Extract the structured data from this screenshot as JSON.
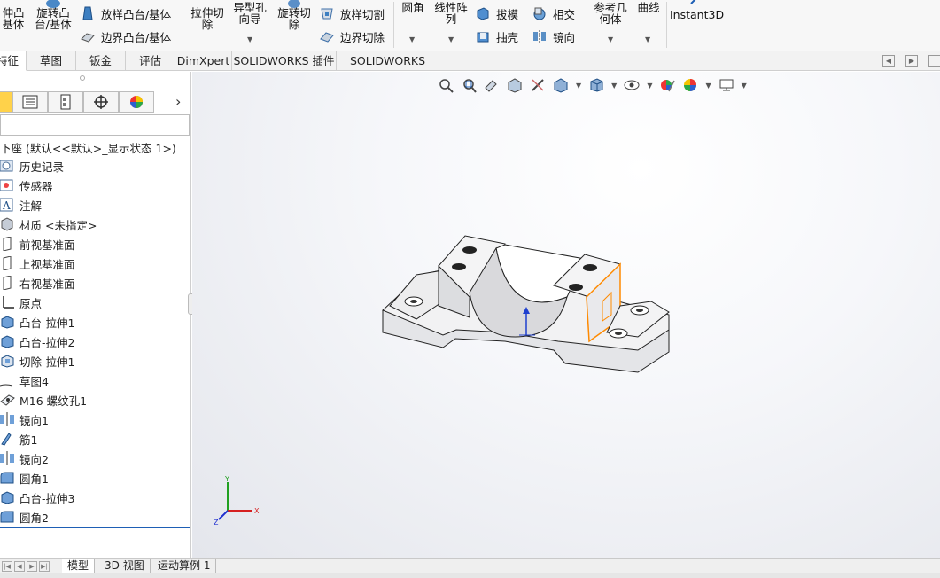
{
  "ribbon": {
    "extrude_boss": [
      "伸凸",
      "基体"
    ],
    "revolve_boss": [
      "旋转凸",
      "台/基体"
    ],
    "loft_boss": "放样凸台/基体",
    "boundary_boss": "边界凸台/基体",
    "extrude_cut": [
      "拉伸切",
      "除"
    ],
    "hole_wizard": [
      "异型孔",
      "向导"
    ],
    "revolve_cut": [
      "旋转切",
      "除"
    ],
    "loft_cut": "放样切割",
    "boundary_cut": "边界切除",
    "fillet": "圆角",
    "linear_pattern": [
      "线性阵",
      "列"
    ],
    "draft": "拔模",
    "shell": "抽壳",
    "intersect": "相交",
    "mirror": "镜向",
    "ref_geometry": [
      "参考几",
      "何体"
    ],
    "curves": "曲线",
    "instant3d": "Instant3D"
  },
  "tabs": [
    "特征",
    "草图",
    "钣金",
    "评估",
    "DimXpert",
    "SOLIDWORKS 插件",
    "SOLIDWORKS MBD"
  ],
  "tree": {
    "root": "下座 (默认<<默认>_显示状态 1>)",
    "items": [
      "历史记录",
      "传感器",
      "注解",
      "材质 <未指定>",
      "前视基准面",
      "上视基准面",
      "右视基准面",
      "原点",
      "凸台-拉伸1",
      "凸台-拉伸2",
      "切除-拉伸1",
      "草图4",
      "M16 螺纹孔1",
      "镜向1",
      "筋1",
      "镜向2",
      "圆角1",
      "凸台-拉伸3",
      "圆角2"
    ]
  },
  "bottom_tabs": [
    "模型",
    "3D 视图",
    "运动算例 1"
  ],
  "triad": {
    "x": "X",
    "y": "Y",
    "z": "Z"
  },
  "colors": {
    "accent": "#1e5fb5",
    "selection": "#ff8a00",
    "axis_x": "#d62020",
    "axis_y": "#20a020",
    "axis_z": "#2030d0"
  }
}
